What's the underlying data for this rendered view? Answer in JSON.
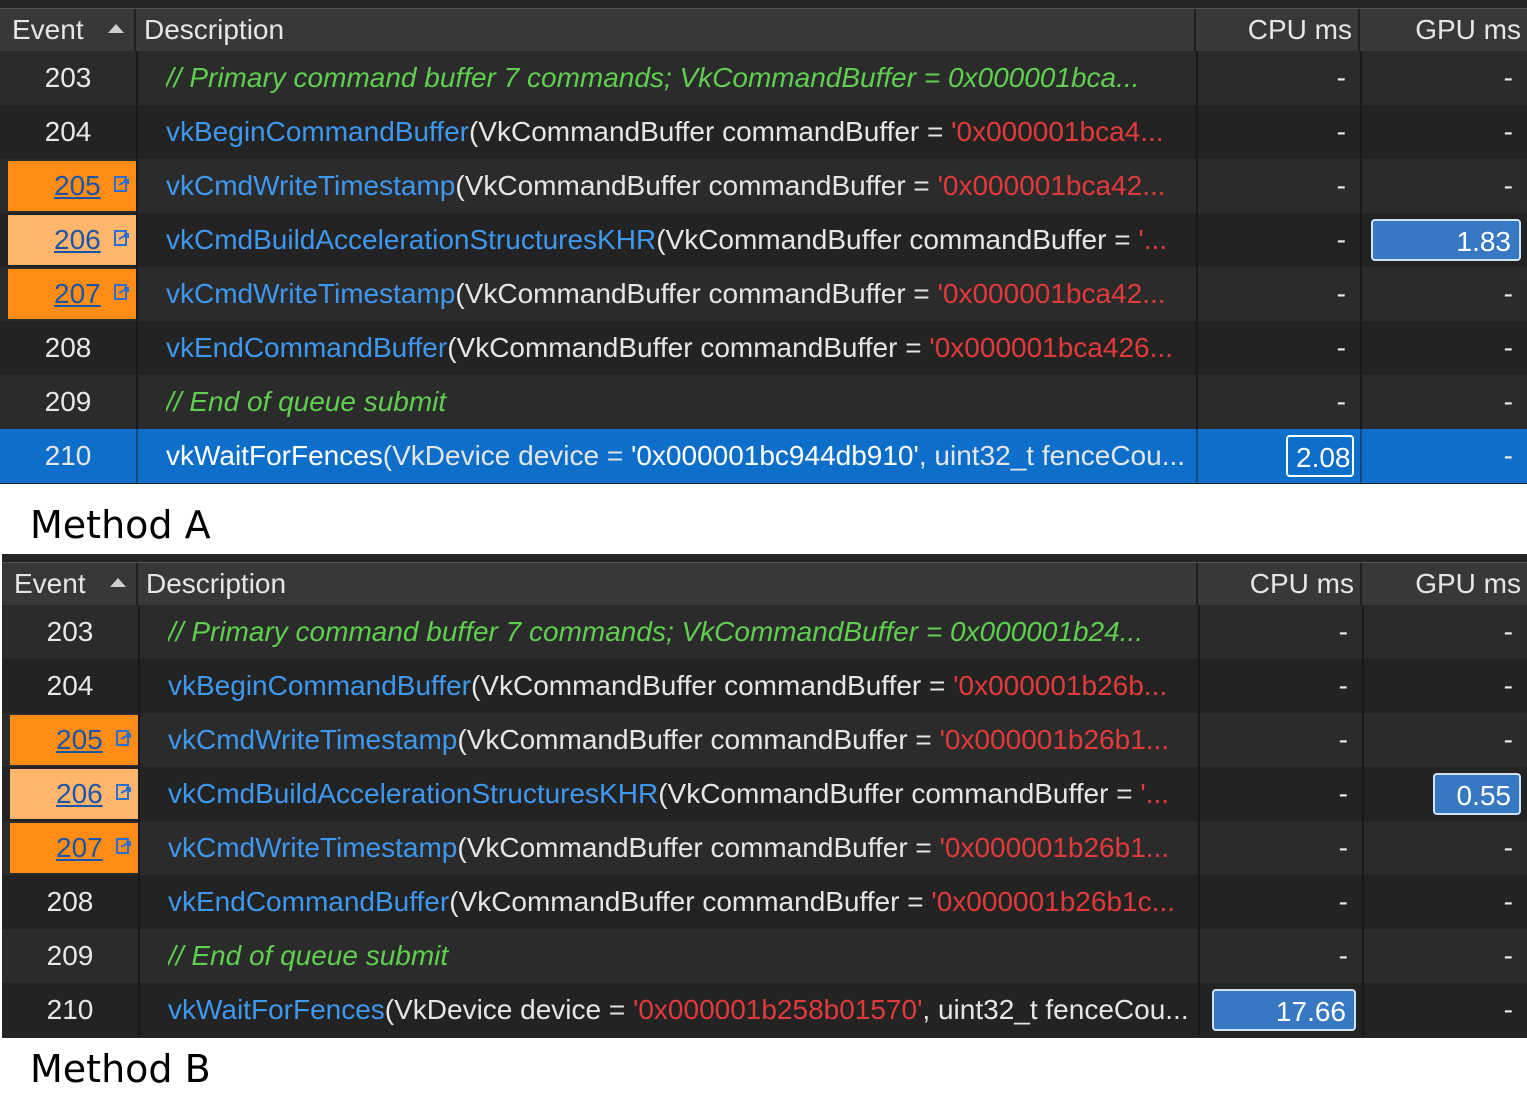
{
  "header": {
    "event": "Event",
    "description": "Description",
    "cpu": "CPU ms",
    "gpu": "GPU ms"
  },
  "method_a": {
    "label": "Method A",
    "rows": [
      {
        "event": "203",
        "comment": "// Primary command buffer 7 commands; VkCommandBuffer = 0x000001bca...",
        "cpu": "-",
        "gpu": "-"
      },
      {
        "event": "204",
        "fn": "vkBeginCommandBuffer",
        "args": "(VkCommandBuffer commandBuffer = ",
        "addr": "'0x000001bca4...",
        "cpu": "-",
        "gpu": "-"
      },
      {
        "event": "205",
        "fn": "vkCmdWriteTimestamp",
        "args": "(VkCommandBuffer commandBuffer = ",
        "addr": "'0x000001bca42...",
        "cpu": "-",
        "gpu": "-"
      },
      {
        "event": "206",
        "fn": "vkCmdBuildAccelerationStructuresKHR",
        "args": "(VkCommandBuffer commandBuffer = ",
        "addr": "'...",
        "cpu": "-",
        "gpu": "1.83"
      },
      {
        "event": "207",
        "fn": "vkCmdWriteTimestamp",
        "args": "(VkCommandBuffer commandBuffer = ",
        "addr": "'0x000001bca42...",
        "cpu": "-",
        "gpu": "-"
      },
      {
        "event": "208",
        "fn": "vkEndCommandBuffer",
        "args": "(VkCommandBuffer commandBuffer = ",
        "addr": "'0x000001bca426...",
        "cpu": "-",
        "gpu": "-"
      },
      {
        "event": "209",
        "comment": "// End of queue submit",
        "cpu": "-",
        "gpu": "-"
      },
      {
        "event": "210",
        "fn": "vkWaitForFences",
        "args": "(VkDevice device = ",
        "addr": "'0x000001bc944db910'",
        "args2": ", uint32_t fenceCou...",
        "cpu": "2.08",
        "gpu": "-"
      }
    ]
  },
  "method_b": {
    "label": "Method B",
    "rows": [
      {
        "event": "203",
        "comment": "// Primary command buffer 7 commands; VkCommandBuffer = 0x000001b24...",
        "cpu": "-",
        "gpu": "-"
      },
      {
        "event": "204",
        "fn": "vkBeginCommandBuffer",
        "args": "(VkCommandBuffer commandBuffer = ",
        "addr": "'0x000001b26b...",
        "cpu": "-",
        "gpu": "-"
      },
      {
        "event": "205",
        "fn": "vkCmdWriteTimestamp",
        "args": "(VkCommandBuffer commandBuffer = ",
        "addr": "'0x000001b26b1...",
        "cpu": "-",
        "gpu": "-"
      },
      {
        "event": "206",
        "fn": "vkCmdBuildAccelerationStructuresKHR",
        "args": "(VkCommandBuffer commandBuffer = ",
        "addr": "'...",
        "cpu": "-",
        "gpu": "0.55"
      },
      {
        "event": "207",
        "fn": "vkCmdWriteTimestamp",
        "args": "(VkCommandBuffer commandBuffer = ",
        "addr": "'0x000001b26b1...",
        "cpu": "-",
        "gpu": "-"
      },
      {
        "event": "208",
        "fn": "vkEndCommandBuffer",
        "args": "(VkCommandBuffer commandBuffer = ",
        "addr": "'0x000001b26b1c...",
        "cpu": "-",
        "gpu": "-"
      },
      {
        "event": "209",
        "comment": "// End of queue submit",
        "cpu": "-",
        "gpu": "-"
      },
      {
        "event": "210",
        "fn": "vkWaitForFences",
        "args": "(VkDevice device = ",
        "addr": "'0x000001b258b01570'",
        "args2": ", uint32_t fenceCou...",
        "cpu": "17.66",
        "gpu": "-"
      }
    ]
  },
  "colors": {
    "highlight_orange": "#ff8c14",
    "highlight_light_orange": "#ffb56b",
    "selection_blue": "#0e6fcb",
    "function_blue": "#3d98f0",
    "address_red": "#e23a3a",
    "comment_green": "#5fcf4f"
  },
  "icons": {
    "link": "bookmark-link-icon",
    "sort": "sort-ascending-icon"
  }
}
